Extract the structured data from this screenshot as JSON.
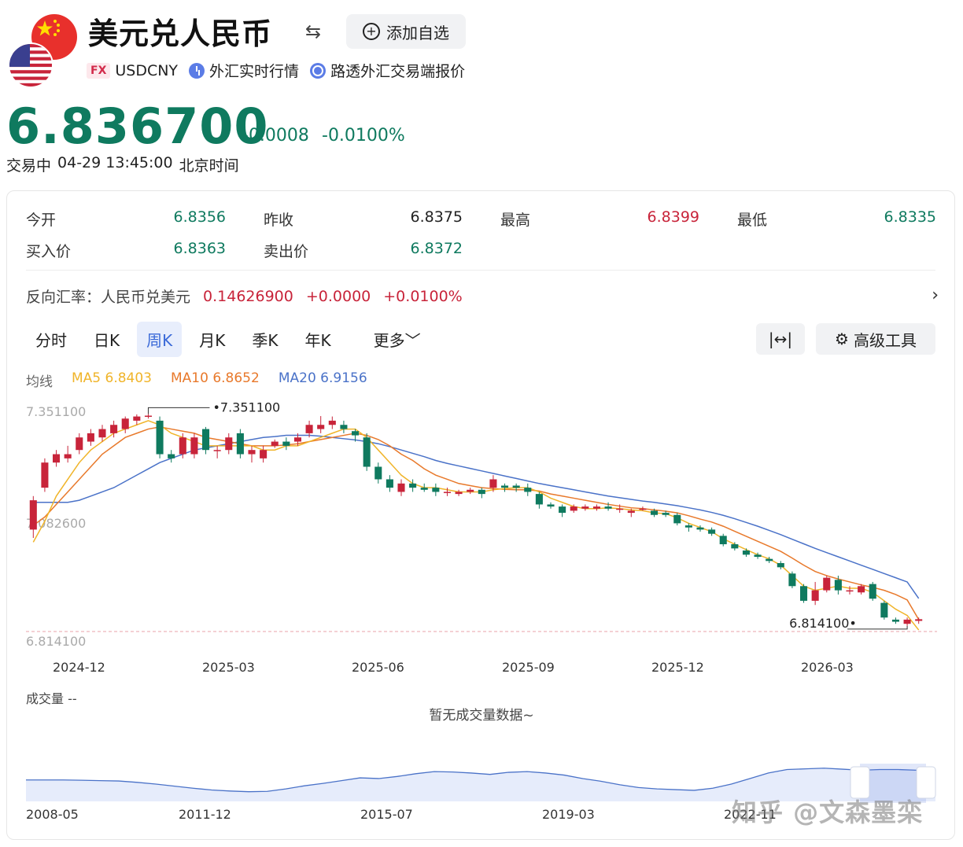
{
  "header": {
    "title": "美元兑人民币",
    "add_watch_label": "添加自选",
    "fx_badge": "FX",
    "symbol": "USDCNY",
    "tag_realtime": "外汇实时行情",
    "tag_reuters": "路透外汇交易端报价"
  },
  "quote": {
    "price": "6.836700",
    "change": "-0.0008",
    "change_pct": "-0.0100%",
    "status": "交易中",
    "time": "04-29 13:45:00",
    "timezone": "北京时间"
  },
  "stats": {
    "open_label": "今开",
    "open": "6.8356",
    "prev_close_label": "昨收",
    "prev_close": "6.8375",
    "high_label": "最高",
    "high": "6.8399",
    "low_label": "最低",
    "low": "6.8335",
    "bid_label": "买入价",
    "bid": "6.8363",
    "ask_label": "卖出价",
    "ask": "6.8372"
  },
  "reverse": {
    "label": "反向汇率：人民币兑美元",
    "rate": "0.14626900",
    "change": "+0.0000",
    "change_pct": "+0.0100%"
  },
  "tabs": [
    "分时",
    "日K",
    "周K",
    "月K",
    "季K",
    "年K"
  ],
  "more_label": "更多",
  "tools_label": "高级工具",
  "ma": {
    "label": "均线",
    "ma5": "MA5 6.8403",
    "ma10": "MA10 6.8652",
    "ma20": "MA20 6.9156"
  },
  "colors": {
    "up": "#c8243a",
    "down": "#0f7a5f",
    "ma5": "#f0b429",
    "ma10": "#e8792b",
    "ma20": "#4a72c8"
  },
  "chart_data": {
    "type": "candlestick",
    "y_ticks": [
      "7.351100",
      "7.082600",
      "6.814100"
    ],
    "ylim": [
      6.8141,
      7.3511
    ],
    "max_label": "7.351100",
    "min_label": "6.814100",
    "last_price": 6.8367,
    "x_ticks": [
      "2024-12",
      "2025-03",
      "2025-06",
      "2025-09",
      "2025-12",
      "2026-03"
    ],
    "candles": [
      {
        "o": 7.08,
        "c": 7.15,
        "h": 7.16,
        "l": 7.06
      },
      {
        "o": 7.18,
        "c": 7.24,
        "h": 7.25,
        "l": 7.17
      },
      {
        "o": 7.24,
        "c": 7.26,
        "h": 7.27,
        "l": 7.23
      },
      {
        "o": 7.25,
        "c": 7.26,
        "h": 7.28,
        "l": 7.24
      },
      {
        "o": 7.27,
        "c": 7.3,
        "h": 7.31,
        "l": 7.26
      },
      {
        "o": 7.29,
        "c": 7.31,
        "h": 7.32,
        "l": 7.28
      },
      {
        "o": 7.3,
        "c": 7.32,
        "h": 7.33,
        "l": 7.29
      },
      {
        "o": 7.31,
        "c": 7.33,
        "h": 7.34,
        "l": 7.3
      },
      {
        "o": 7.32,
        "c": 7.345,
        "h": 7.35,
        "l": 7.31
      },
      {
        "o": 7.34,
        "c": 7.35,
        "h": 7.355,
        "l": 7.33
      },
      {
        "o": 7.35,
        "c": 7.352,
        "h": 7.356,
        "l": 7.345
      },
      {
        "o": 7.34,
        "c": 7.26,
        "h": 7.35,
        "l": 7.25
      },
      {
        "o": 7.26,
        "c": 7.25,
        "h": 7.27,
        "l": 7.24
      },
      {
        "o": 7.26,
        "c": 7.3,
        "h": 7.31,
        "l": 7.25
      },
      {
        "o": 7.26,
        "c": 7.3,
        "h": 7.31,
        "l": 7.25
      },
      {
        "o": 7.32,
        "c": 7.27,
        "h": 7.325,
        "l": 7.26
      },
      {
        "o": 7.27,
        "c": 7.27,
        "h": 7.28,
        "l": 7.25
      },
      {
        "o": 7.27,
        "c": 7.3,
        "h": 7.31,
        "l": 7.26
      },
      {
        "o": 7.31,
        "c": 7.26,
        "h": 7.32,
        "l": 7.25
      },
      {
        "o": 7.26,
        "c": 7.27,
        "h": 7.28,
        "l": 7.24
      },
      {
        "o": 7.25,
        "c": 7.27,
        "h": 7.28,
        "l": 7.24
      },
      {
        "o": 7.28,
        "c": 7.29,
        "h": 7.295,
        "l": 7.275
      },
      {
        "o": 7.29,
        "c": 7.28,
        "h": 7.3,
        "l": 7.27
      },
      {
        "o": 7.29,
        "c": 7.3,
        "h": 7.31,
        "l": 7.28
      },
      {
        "o": 7.31,
        "c": 7.33,
        "h": 7.34,
        "l": 7.3
      },
      {
        "o": 7.32,
        "c": 7.33,
        "h": 7.351,
        "l": 7.31
      },
      {
        "o": 7.33,
        "c": 7.34,
        "h": 7.35,
        "l": 7.32
      },
      {
        "o": 7.33,
        "c": 7.32,
        "h": 7.34,
        "l": 7.31
      },
      {
        "o": 7.315,
        "c": 7.305,
        "h": 7.32,
        "l": 7.29
      },
      {
        "o": 7.3,
        "c": 7.23,
        "h": 7.31,
        "l": 7.22
      },
      {
        "o": 7.23,
        "c": 7.2,
        "h": 7.24,
        "l": 7.19
      },
      {
        "o": 7.2,
        "c": 7.18,
        "h": 7.21,
        "l": 7.17
      },
      {
        "o": 7.17,
        "c": 7.19,
        "h": 7.2,
        "l": 7.16
      },
      {
        "o": 7.19,
        "c": 7.18,
        "h": 7.2,
        "l": 7.17
      },
      {
        "o": 7.18,
        "c": 7.175,
        "h": 7.19,
        "l": 7.17
      },
      {
        "o": 7.18,
        "c": 7.17,
        "h": 7.19,
        "l": 7.16
      },
      {
        "o": 7.17,
        "c": 7.17,
        "h": 7.18,
        "l": 7.16
      },
      {
        "o": 7.165,
        "c": 7.17,
        "h": 7.175,
        "l": 7.16
      },
      {
        "o": 7.17,
        "c": 7.175,
        "h": 7.18,
        "l": 7.165
      },
      {
        "o": 7.175,
        "c": 7.165,
        "h": 7.18,
        "l": 7.155
      },
      {
        "o": 7.18,
        "c": 7.2,
        "h": 7.21,
        "l": 7.17
      },
      {
        "o": 7.185,
        "c": 7.18,
        "h": 7.19,
        "l": 7.17
      },
      {
        "o": 7.185,
        "c": 7.18,
        "h": 7.19,
        "l": 7.17
      },
      {
        "o": 7.18,
        "c": 7.17,
        "h": 7.19,
        "l": 7.16
      },
      {
        "o": 7.165,
        "c": 7.14,
        "h": 7.17,
        "l": 7.13
      },
      {
        "o": 7.14,
        "c": 7.135,
        "h": 7.145,
        "l": 7.13
      },
      {
        "o": 7.135,
        "c": 7.12,
        "h": 7.14,
        "l": 7.11
      },
      {
        "o": 7.125,
        "c": 7.135,
        "h": 7.14,
        "l": 7.12
      },
      {
        "o": 7.13,
        "c": 7.135,
        "h": 7.14,
        "l": 7.125
      },
      {
        "o": 7.13,
        "c": 7.135,
        "h": 7.14,
        "l": 7.125
      },
      {
        "o": 7.135,
        "c": 7.13,
        "h": 7.145,
        "l": 7.125
      },
      {
        "o": 7.13,
        "c": 7.13,
        "h": 7.14,
        "l": 7.12
      },
      {
        "o": 7.12,
        "c": 7.125,
        "h": 7.13,
        "l": 7.11
      },
      {
        "o": 7.13,
        "c": 7.13,
        "h": 7.135,
        "l": 7.125
      },
      {
        "o": 7.125,
        "c": 7.115,
        "h": 7.13,
        "l": 7.11
      },
      {
        "o": 7.12,
        "c": 7.115,
        "h": 7.125,
        "l": 7.11
      },
      {
        "o": 7.115,
        "c": 7.095,
        "h": 7.12,
        "l": 7.09
      },
      {
        "o": 7.09,
        "c": 7.085,
        "h": 7.095,
        "l": 7.075
      },
      {
        "o": 7.085,
        "c": 7.08,
        "h": 7.09,
        "l": 7.075
      },
      {
        "o": 7.08,
        "c": 7.07,
        "h": 7.085,
        "l": 7.065
      },
      {
        "o": 7.065,
        "c": 7.045,
        "h": 7.07,
        "l": 7.04
      },
      {
        "o": 7.045,
        "c": 7.035,
        "h": 7.05,
        "l": 7.03
      },
      {
        "o": 7.03,
        "c": 7.02,
        "h": 7.035,
        "l": 7.015
      },
      {
        "o": 7.02,
        "c": 7.015,
        "h": 7.025,
        "l": 7.01
      },
      {
        "o": 7.01,
        "c": 7.005,
        "h": 7.015,
        "l": 7.0
      },
      {
        "o": 7.0,
        "c": 6.99,
        "h": 7.005,
        "l": 6.985
      },
      {
        "o": 6.975,
        "c": 6.945,
        "h": 6.98,
        "l": 6.94
      },
      {
        "o": 6.945,
        "c": 6.91,
        "h": 6.95,
        "l": 6.905
      },
      {
        "o": 6.91,
        "c": 6.935,
        "h": 6.955,
        "l": 6.9
      },
      {
        "o": 6.935,
        "c": 6.965,
        "h": 6.97,
        "l": 6.93
      },
      {
        "o": 6.96,
        "c": 6.935,
        "h": 6.97,
        "l": 6.925
      },
      {
        "o": 6.935,
        "c": 6.935,
        "h": 6.945,
        "l": 6.925
      },
      {
        "o": 6.93,
        "c": 6.945,
        "h": 6.95,
        "l": 6.925
      },
      {
        "o": 6.95,
        "c": 6.915,
        "h": 6.955,
        "l": 6.91
      },
      {
        "o": 6.905,
        "c": 6.87,
        "h": 6.91,
        "l": 6.865
      },
      {
        "o": 6.865,
        "c": 6.86,
        "h": 6.87,
        "l": 6.855
      },
      {
        "o": 6.855,
        "c": 6.865,
        "h": 6.87,
        "l": 6.85
      },
      {
        "o": 6.862,
        "c": 6.866,
        "h": 6.87,
        "l": 6.855
      }
    ],
    "ma5": [
      7.05,
      7.1,
      7.16,
      7.2,
      7.24,
      7.27,
      7.29,
      7.31,
      7.32,
      7.33,
      7.34,
      7.33,
      7.31,
      7.3,
      7.29,
      7.28,
      7.28,
      7.28,
      7.28,
      7.28,
      7.27,
      7.27,
      7.28,
      7.28,
      7.29,
      7.3,
      7.31,
      7.32,
      7.32,
      7.3,
      7.27,
      7.24,
      7.21,
      7.19,
      7.18,
      7.18,
      7.175,
      7.17,
      7.17,
      7.17,
      7.175,
      7.178,
      7.18,
      7.18,
      7.17,
      7.155,
      7.145,
      7.135,
      7.13,
      7.13,
      7.132,
      7.13,
      7.127,
      7.125,
      7.12,
      7.118,
      7.108,
      7.095,
      7.085,
      7.075,
      7.058,
      7.045,
      7.032,
      7.02,
      7.01,
      6.995,
      6.97,
      6.945,
      6.935,
      6.94,
      6.945,
      6.94,
      6.94,
      6.93,
      6.91,
      6.89,
      6.875,
      6.8403
    ],
    "ma10": [
      7.09,
      7.11,
      7.14,
      7.17,
      7.2,
      7.23,
      7.26,
      7.28,
      7.3,
      7.31,
      7.32,
      7.325,
      7.32,
      7.315,
      7.31,
      7.3,
      7.295,
      7.29,
      7.285,
      7.28,
      7.28,
      7.28,
      7.282,
      7.285,
      7.29,
      7.295,
      7.3,
      7.305,
      7.31,
      7.305,
      7.295,
      7.28,
      7.26,
      7.245,
      7.225,
      7.21,
      7.2,
      7.19,
      7.185,
      7.18,
      7.178,
      7.176,
      7.175,
      7.175,
      7.172,
      7.165,
      7.16,
      7.155,
      7.15,
      7.145,
      7.14,
      7.136,
      7.132,
      7.13,
      7.127,
      7.124,
      7.12,
      7.113,
      7.105,
      7.098,
      7.088,
      7.076,
      7.064,
      7.052,
      7.04,
      7.028,
      7.012,
      6.995,
      6.98,
      6.97,
      6.962,
      6.955,
      6.948,
      6.942,
      6.935,
      6.925,
      6.912,
      6.8652
    ],
    "ma20": [
      7.145,
      7.145,
      7.145,
      7.145,
      7.15,
      7.16,
      7.17,
      7.18,
      7.195,
      7.21,
      7.225,
      7.24,
      7.25,
      7.26,
      7.27,
      7.275,
      7.28,
      7.285,
      7.29,
      7.295,
      7.3,
      7.302,
      7.305,
      7.305,
      7.305,
      7.303,
      7.3,
      7.297,
      7.294,
      7.29,
      7.285,
      7.278,
      7.27,
      7.262,
      7.254,
      7.245,
      7.238,
      7.232,
      7.226,
      7.22,
      7.214,
      7.208,
      7.202,
      7.196,
      7.19,
      7.185,
      7.18,
      7.175,
      7.17,
      7.165,
      7.16,
      7.156,
      7.152,
      7.148,
      7.145,
      7.141,
      7.137,
      7.132,
      7.127,
      7.121,
      7.114,
      7.106,
      7.097,
      7.088,
      7.078,
      7.068,
      7.057,
      7.046,
      7.035,
      7.025,
      7.015,
      7.005,
      6.995,
      6.985,
      6.975,
      6.965,
      6.955,
      6.9156
    ]
  },
  "volume": {
    "title": "成交量 --",
    "empty": "暂无成交量数据~"
  },
  "overview": {
    "x_ticks": [
      "2008-05",
      "2011-12",
      "2015-07",
      "2019-03",
      "2022-11"
    ],
    "series": [
      0.62,
      0.62,
      0.62,
      0.61,
      0.6,
      0.59,
      0.55,
      0.5,
      0.44,
      0.38,
      0.33,
      0.3,
      0.28,
      0.29,
      0.36,
      0.45,
      0.52,
      0.6,
      0.68,
      0.66,
      0.72,
      0.8,
      0.86,
      0.85,
      0.82,
      0.78,
      0.84,
      0.86,
      0.82,
      0.76,
      0.66,
      0.58,
      0.48,
      0.4,
      0.36,
      0.34,
      0.32,
      0.38,
      0.5,
      0.66,
      0.82,
      0.92,
      0.94,
      0.96,
      0.93,
      0.9,
      0.92,
      0.92,
      0.9,
      0.88
    ]
  },
  "watermark": "知乎 @文森墨栾"
}
